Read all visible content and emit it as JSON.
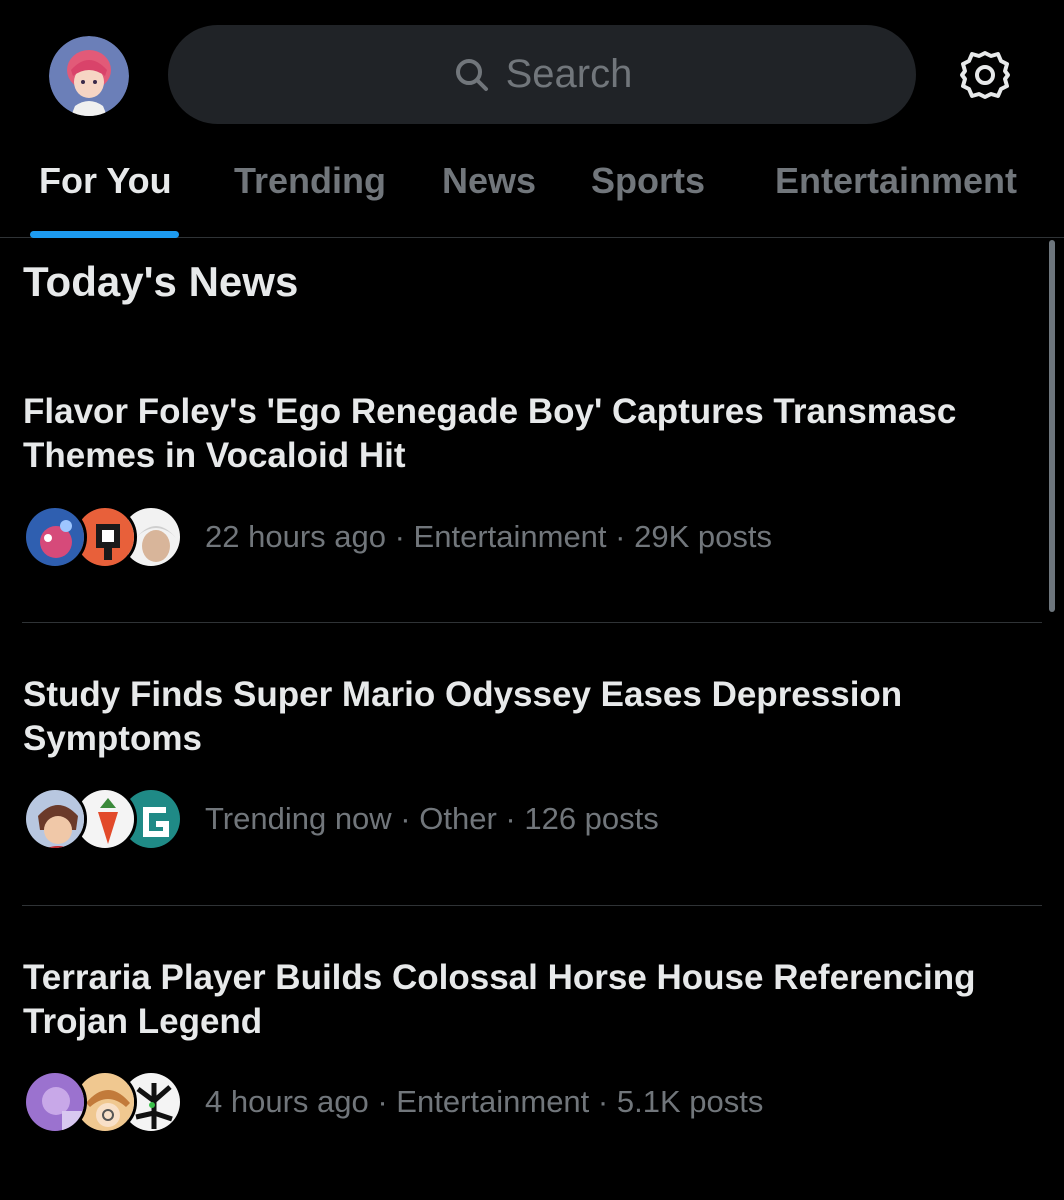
{
  "search": {
    "placeholder": "Search"
  },
  "tabs": [
    {
      "label": "For You",
      "active": true
    },
    {
      "label": "Trending",
      "active": false
    },
    {
      "label": "News",
      "active": false
    },
    {
      "label": "Sports",
      "active": false
    },
    {
      "label": "Entertainment",
      "active": false
    }
  ],
  "section": {
    "title": "Today's News"
  },
  "news": [
    {
      "headline": "Flavor Foley's 'Ego Renegade Boy' Captures Transmasc Themes in Vocaloid Hit",
      "time": "22 hours ago",
      "category": "Entertainment",
      "posts": "29K posts"
    },
    {
      "headline": "Study Finds Super Mario Odyssey Eases Depression Symptoms",
      "time": "Trending now",
      "category": "Other",
      "posts": "126 posts"
    },
    {
      "headline": "Terraria Player Builds Colossal Horse House Referencing Trojan Legend",
      "time": "4 hours ago",
      "category": "Entertainment",
      "posts": "5.1K posts"
    }
  ],
  "colors": {
    "background": "#000000",
    "accent": "#1d9bf0",
    "text_primary": "#e7e9ea",
    "text_secondary": "#71767b",
    "search_bg": "#202327",
    "divider": "#2f3336"
  },
  "icons": {
    "search": "search-icon",
    "settings": "gear-icon"
  }
}
